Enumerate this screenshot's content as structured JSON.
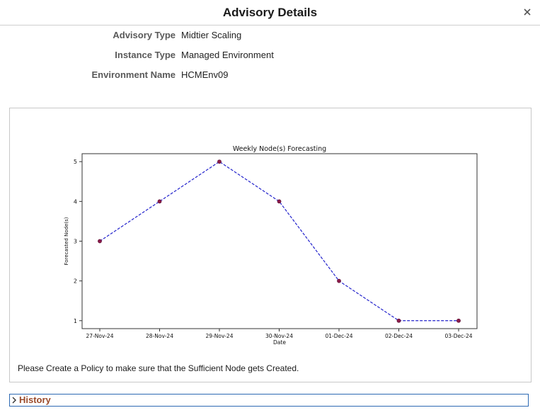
{
  "dialog": {
    "title": "Advisory Details",
    "close_icon": "close-icon"
  },
  "fields": [
    {
      "label": "Advisory Type",
      "value": "Midtier Scaling"
    },
    {
      "label": "Instance Type",
      "value": "Managed Environment"
    },
    {
      "label": "Environment Name",
      "value": "HCMEnv09"
    }
  ],
  "chart_data": {
    "type": "line",
    "title": "Weekly Node(s) Forecasting",
    "xlabel": "Date",
    "ylabel": "Forecasted Node(s)",
    "categories": [
      "27-Nov-24",
      "28-Nov-24",
      "29-Nov-24",
      "30-Nov-24",
      "01-Dec-24",
      "02-Dec-24",
      "03-Dec-24"
    ],
    "values": [
      3,
      4,
      5,
      4,
      2,
      1,
      1
    ],
    "y_ticks": [
      1,
      2,
      3,
      4,
      5
    ],
    "ylim": [
      0.8,
      5.2
    ],
    "grid": false,
    "line_color": "#2222cc",
    "marker_color": "#8b1a4a"
  },
  "advice": "Please Create a Policy to make sure that the Sufficient Node gets Created.",
  "history": {
    "label": "History",
    "chevron_icon": "chevron-right-icon"
  }
}
